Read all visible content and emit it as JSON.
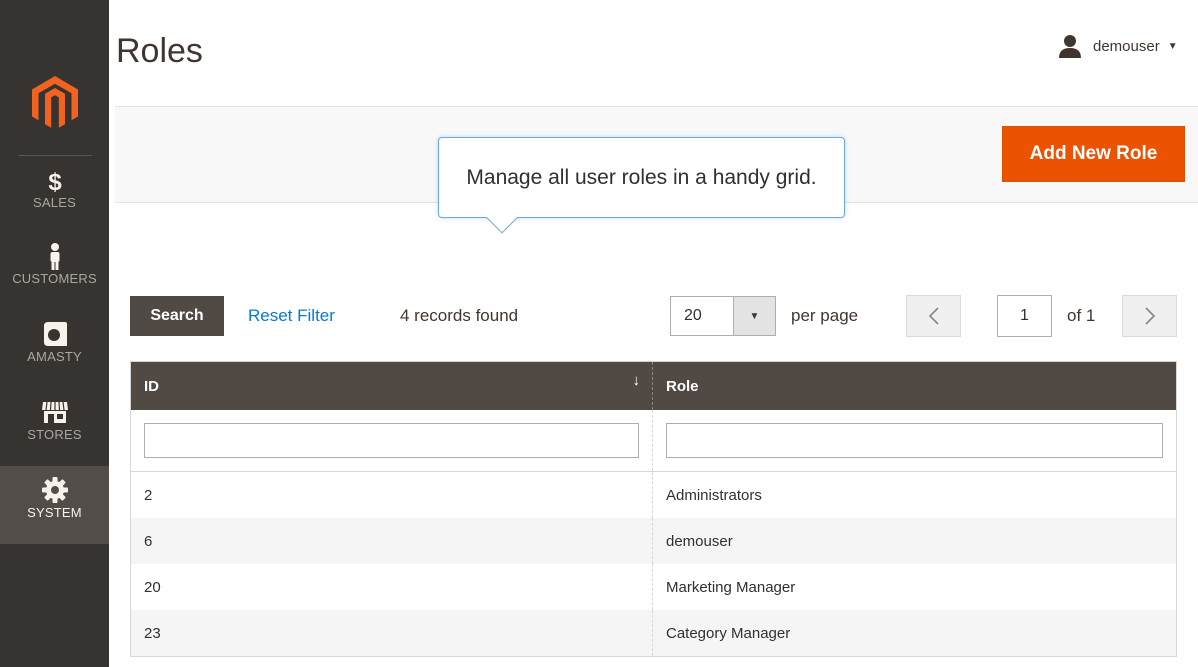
{
  "header": {
    "title": "Roles",
    "user": "demouser"
  },
  "sidebar": {
    "items": [
      {
        "label": "SALES",
        "icon": "dollar-icon"
      },
      {
        "label": "CUSTOMERS",
        "icon": "person-icon"
      },
      {
        "label": "AMASTY",
        "icon": "amasty-logo-icon"
      },
      {
        "label": "STORES",
        "icon": "storefront-icon"
      },
      {
        "label": "SYSTEM",
        "icon": "gear-icon",
        "active": true
      }
    ]
  },
  "actions": {
    "add_label": "Add New Role"
  },
  "tooltip": {
    "text": "Manage all user roles in a handy grid."
  },
  "grid_controls": {
    "search_label": "Search",
    "reset_label": "Reset Filter",
    "records_text": "4 records found",
    "per_page_value": "20",
    "per_page_label": "per page",
    "current_page": "1",
    "page_of": "of 1"
  },
  "table": {
    "columns": [
      "ID",
      "Role"
    ],
    "sort_indicator": "↓",
    "rows": [
      {
        "id": "2",
        "role": "Administrators"
      },
      {
        "id": "6",
        "role": "demouser"
      },
      {
        "id": "20",
        "role": "Marketing Manager"
      },
      {
        "id": "23",
        "role": "Category Manager"
      }
    ]
  },
  "colors": {
    "sidebar_bg": "#373330",
    "active_nav_bg": "#524d49",
    "accent": "#eb5202",
    "link": "#007bdb",
    "table_header_bg": "#514943",
    "tooltip_border": "#6aa9dc"
  }
}
